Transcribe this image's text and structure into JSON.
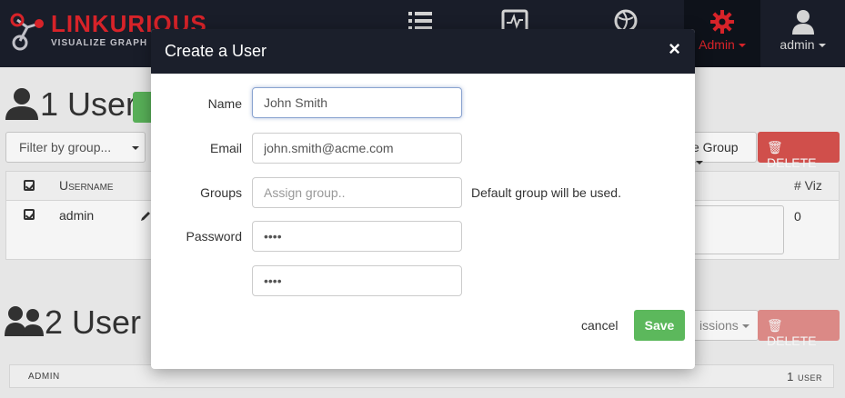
{
  "brand": {
    "name": "LINKURIOUS",
    "tagline": "VISUALIZE GRAPH DA"
  },
  "nav": {
    "icons": [
      "list-icon",
      "dashboard-icon",
      "globe-icon"
    ],
    "admin_label": "Admin",
    "user_label": "admin"
  },
  "users_section": {
    "title": "1 User",
    "filter_label": "Filter by group...",
    "group_button": "e Group",
    "delete_label": "DELETE",
    "columns": {
      "username": "Username",
      "viz": "# Viz"
    },
    "rows": [
      {
        "username": "admin",
        "viz": "0"
      }
    ]
  },
  "groups_section": {
    "title": "2 User",
    "permissions_button": "issions",
    "delete_label": "DELETE",
    "row_name": "admin",
    "row_count": "1 user"
  },
  "modal": {
    "title": "Create a User",
    "close_symbol": "×",
    "name_label": "Name",
    "name_value": "John Smith",
    "email_label": "Email",
    "email_value": "john.smith@acme.com",
    "groups_label": "Groups",
    "groups_placeholder": "Assign group..",
    "groups_hint": "Default group will be used.",
    "password_label": "Password",
    "password_value": "••••",
    "password_confirm_value": "••••",
    "cancel_label": "cancel",
    "save_label": "Save"
  },
  "colors": {
    "nav_bg": "#1b1f2b",
    "brand_red": "#e0252b",
    "save_green": "#5cb85c",
    "delete_red": "#d9534f"
  }
}
